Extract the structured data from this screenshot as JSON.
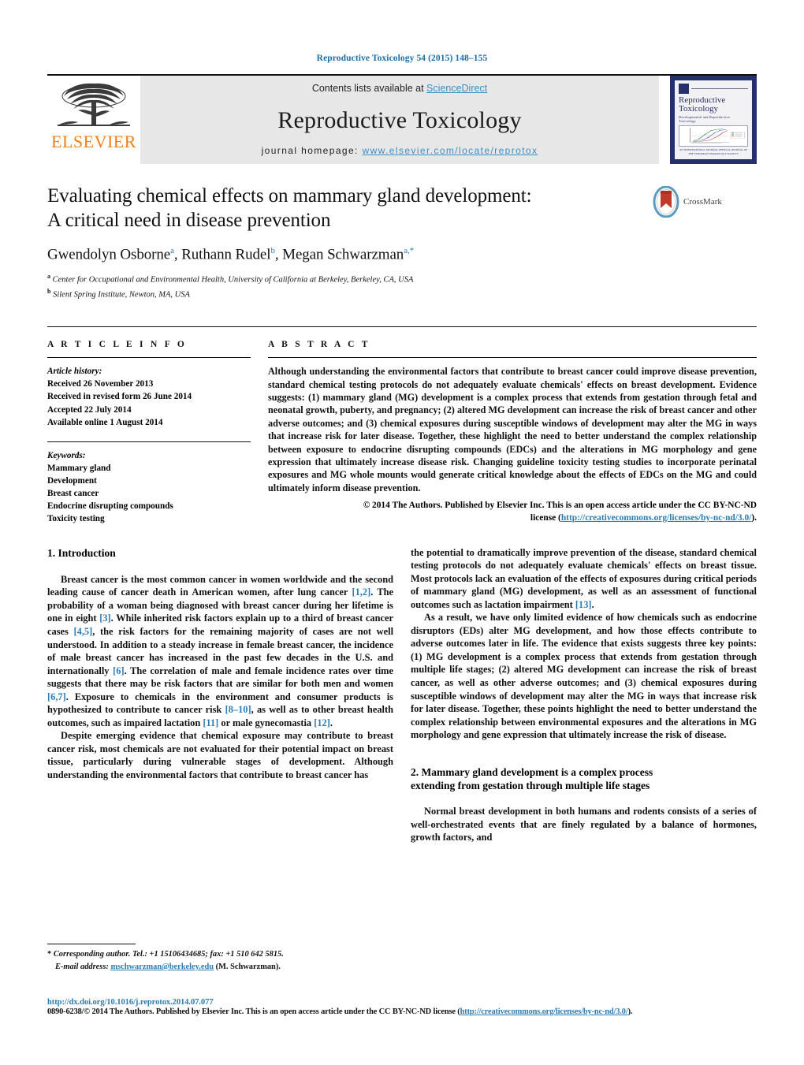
{
  "running_head": "Reproductive Toxicology 54 (2015) 148–155",
  "masthead": {
    "contents_prefix": "Contents lists available at ",
    "sciencedirect": "ScienceDirect",
    "journal_title": "Reproductive Toxicology",
    "homepage_prefix": "journal homepage: ",
    "homepage_url": "www.elsevier.com/locate/reprotox",
    "publisher": "ELSEVIER",
    "cover": {
      "name_line1": "Reproductive",
      "name_line2": "Toxicology",
      "subtitle": "Developmental and Reproductive Toxicology",
      "footer": "AN INTERNATIONAL JOURNAL\nOFFICIAL JOURNAL OF THE EUROPEAN TERATOLOGY SOCIETY"
    }
  },
  "article": {
    "title_line1": "Evaluating chemical effects on mammary gland development:",
    "title_line2": "A critical need in disease prevention",
    "authors": [
      {
        "name": "Gwendolyn Osborne",
        "marks": "a"
      },
      {
        "name": "Ruthann Rudel",
        "marks": "b"
      },
      {
        "name": "Megan Schwarzman",
        "marks": "a,*"
      }
    ],
    "affiliations": [
      {
        "mark": "a",
        "text": "Center for Occupational and Environmental Health, University of California at Berkeley, Berkeley, CA, USA"
      },
      {
        "mark": "b",
        "text": "Silent Spring Institute, Newton, MA, USA"
      }
    ],
    "crossmark_label": "CrossMark"
  },
  "article_info": {
    "heading": "A R T I C L E   I N F O",
    "history_label": "Article history:",
    "history": [
      "Received 26 November 2013",
      "Received in revised form 26 June 2014",
      "Accepted 22 July 2014",
      "Available online 1 August 2014"
    ],
    "keywords_label": "Keywords:",
    "keywords": [
      "Mammary gland",
      "Development",
      "Breast cancer",
      "Endocrine disrupting compounds",
      "Toxicity testing"
    ]
  },
  "abstract": {
    "heading": "A B S T R A C T",
    "text": "Although understanding the environmental factors that contribute to breast cancer could improve disease prevention, standard chemical testing protocols do not adequately evaluate chemicals' effects on breast development. Evidence suggests: (1) mammary gland (MG) development is a complex process that extends from gestation through fetal and neonatal growth, puberty, and pregnancy; (2) altered MG development can increase the risk of breast cancer and other adverse outcomes; and (3) chemical exposures during susceptible windows of development may alter the MG in ways that increase risk for later disease. Together, these highlight the need to better understand the complex relationship between exposure to endocrine disrupting compounds (EDCs) and the alterations in MG morphology and gene expression that ultimately increase disease risk. Changing guideline toxicity testing studies to incorporate perinatal exposures and MG whole mounts would generate critical knowledge about the effects of EDCs on the MG and could ultimately inform disease prevention.",
    "copyright_line1": "© 2014 The Authors. Published by Elsevier Inc. This is an open access article under the CC BY-NC-ND",
    "copyright_line2_prefix": "license (",
    "copyright_license_url": "http://creativecommons.org/licenses/by-nc-nd/3.0/",
    "copyright_line2_suffix": ")."
  },
  "body": {
    "left": {
      "heading": "1.  Introduction",
      "paragraphs": [
        {
          "segments": [
            {
              "t": "Breast cancer is the most common cancer in women worldwide and the second leading cause of cancer death in American women, after lung cancer "
            },
            {
              "t": "[1,2]",
              "ref": true
            },
            {
              "t": ". The probability of a woman being diagnosed with breast cancer during her lifetime is one in eight "
            },
            {
              "t": "[3]",
              "ref": true
            },
            {
              "t": ". While inherited risk factors explain up to a third of breast cancer cases "
            },
            {
              "t": "[4,5]",
              "ref": true
            },
            {
              "t": ", the risk factors for the remaining majority of cases are not well understood. In addition to a steady increase in female breast cancer, the incidence of male breast cancer has increased in the past few decades in the U.S. and internationally "
            },
            {
              "t": "[6]",
              "ref": true
            },
            {
              "t": ". The correlation of male and female incidence rates over time suggests that there may be risk factors that are similar for both men and women "
            },
            {
              "t": "[6,7]",
              "ref": true
            },
            {
              "t": ". Exposure to chemicals in the environment and consumer products is hypothesized to contribute to cancer risk "
            },
            {
              "t": "[8–10]",
              "ref": true
            },
            {
              "t": ", as well as to other breast health outcomes, such as impaired lactation "
            },
            {
              "t": "[11]",
              "ref": true
            },
            {
              "t": " or male gynecomastia "
            },
            {
              "t": "[12]",
              "ref": true
            },
            {
              "t": "."
            }
          ]
        },
        {
          "segments": [
            {
              "t": "Despite emerging evidence that chemical exposure may contribute to breast cancer risk, most chemicals are not evaluated for their potential impact on breast tissue, particularly during vulnerable stages of development. Although understanding the environmental factors that contribute to breast cancer has"
            }
          ]
        }
      ]
    },
    "right": {
      "paragraphs": [
        {
          "segments": [
            {
              "t": "the potential to dramatically improve prevention of the disease, standard chemical testing protocols do not adequately evaluate chemicals' effects on breast tissue. Most protocols lack an evaluation of the effects of exposures during critical periods of mammary gland (MG) development, as well as an assessment of functional outcomes such as lactation impairment "
            },
            {
              "t": "[13]",
              "ref": true
            },
            {
              "t": "."
            }
          ],
          "no_indent": true
        },
        {
          "segments": [
            {
              "t": "As a result, we have only limited evidence of how chemicals such as endocrine disruptors (EDs) alter MG development, and how those effects contribute to adverse outcomes later in life. The evidence that exists suggests three key points: (1) MG development is a complex process that extends from gestation through multiple life stages; (2) altered MG development can increase the risk of breast cancer, as well as other adverse outcomes; and (3) chemical exposures during susceptible windows of development may alter the MG in ways that increase risk for later disease. Together, these points highlight the need to better understand the complex relationship between environmental exposures and the alterations in MG morphology and gene expression that ultimately increase the risk of disease."
            }
          ]
        }
      ],
      "heading2_line1": "2.  Mammary gland development is a complex process",
      "heading2_line2": "extending from gestation through multiple life stages",
      "paragraphs2": [
        {
          "segments": [
            {
              "t": "Normal breast development in both humans and rodents consists of a series of well-orchestrated events that are finely regulated by a balance of hormones, growth factors, and"
            }
          ]
        }
      ]
    }
  },
  "footnote": {
    "star": "*",
    "corresponding": "Corresponding author. Tel.: +1 15106434685; fax: +1 510 642 5815.",
    "email_label": "E-mail address:",
    "email": "mschwarzman@berkeley.edu",
    "email_suffix": "(M. Schwarzman)."
  },
  "page_footer": {
    "doi": "http://dx.doi.org/10.1016/j.reprotox.2014.07.077",
    "issn_prefix": "0890-6238/© 2014 The Authors. Published by Elsevier Inc. This is an open access article under the CC BY-NC-ND license (",
    "issn_license_url": "http://creativecommons.org/licenses/by-nc-nd/3.0/",
    "issn_suffix": ")."
  },
  "colors": {
    "link": "#2b7cb4",
    "sciencedirect": "#3a8fc4",
    "elsevier_orange": "#F07F17",
    "cover_navy": "#26306b",
    "masthead_grey": "#e7e7e7"
  }
}
